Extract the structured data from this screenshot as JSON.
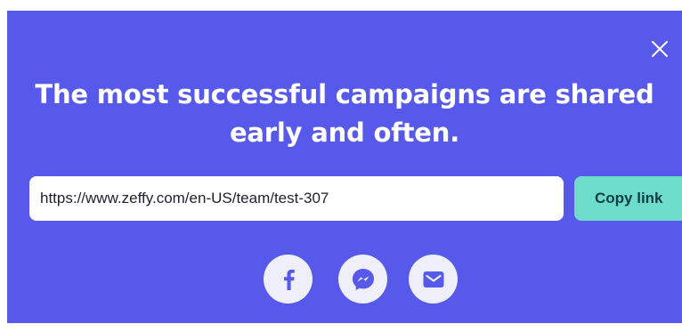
{
  "headline": {
    "line1": "The most successful campaigns are shared",
    "line2": "early and often."
  },
  "share_link": {
    "value": "https://www.zeffy.com/en-US/team/test-307"
  },
  "copy_button": {
    "label": "Copy link"
  },
  "share_options": [
    {
      "icon": "facebook-icon"
    },
    {
      "icon": "messenger-icon"
    },
    {
      "icon": "mail-icon"
    }
  ],
  "colors": {
    "background": "#5659E9",
    "accent": "#6EDCCB",
    "share_circle": "#EEEFFB",
    "icon": "#5659E9"
  }
}
